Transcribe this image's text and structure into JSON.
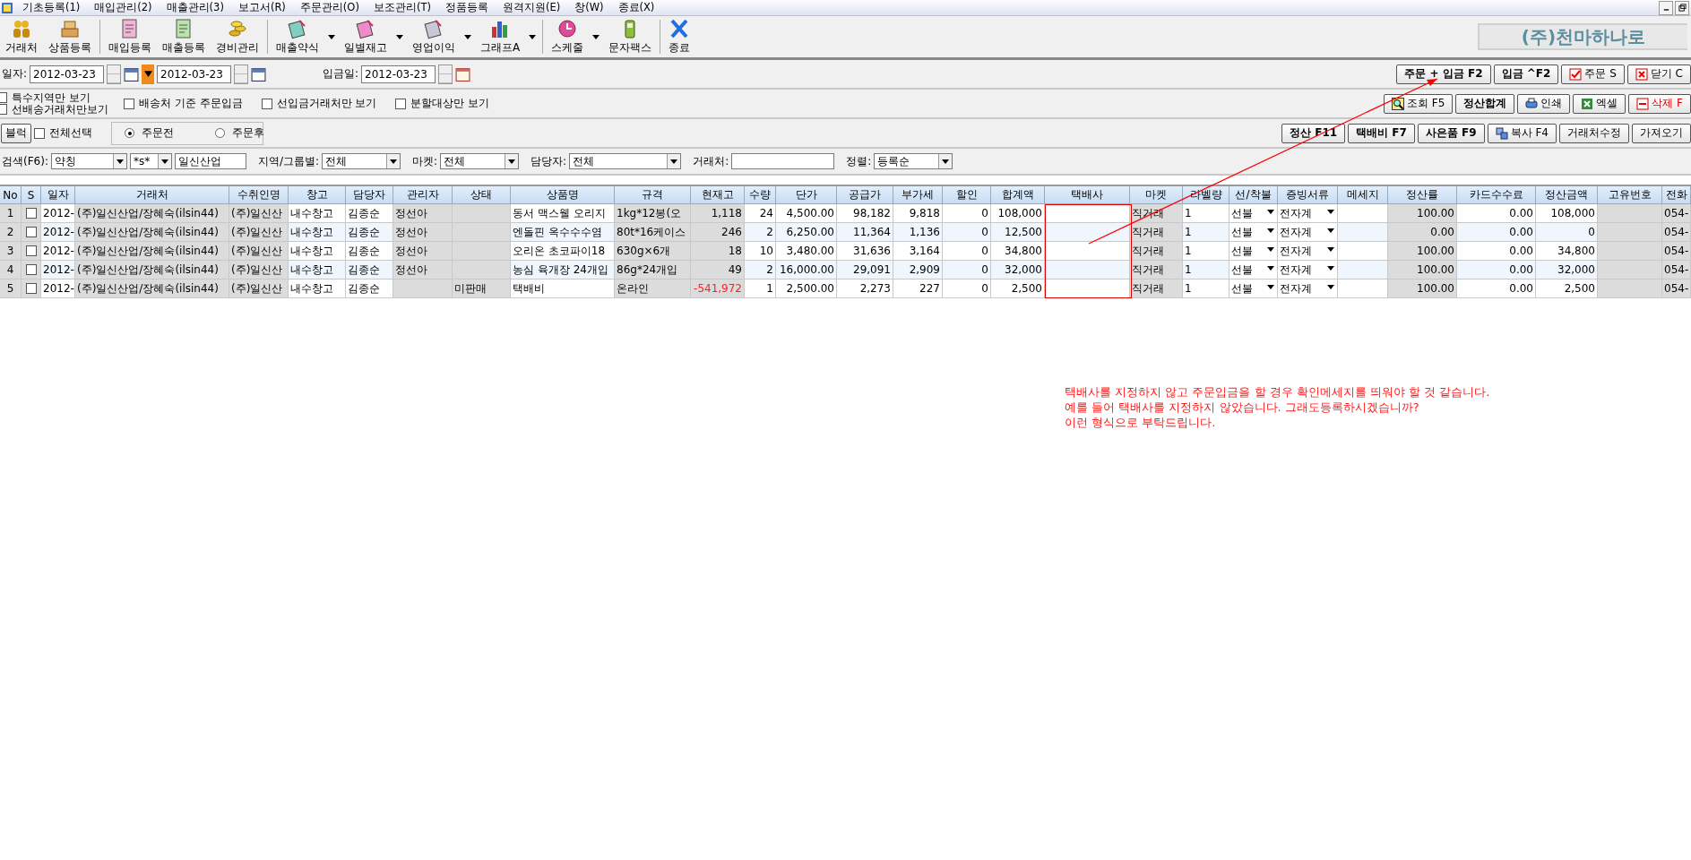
{
  "menu": [
    "기초등록(1)",
    "매입관리(2)",
    "매출관리(3)",
    "보고서(R)",
    "주문관리(O)",
    "보조관리(T)",
    "정품등록",
    "원격지원(E)",
    "창(W)",
    "종료(X)"
  ],
  "toolbar": [
    {
      "label": "거래처",
      "has_menu": false
    },
    {
      "label": "상품등록",
      "has_menu": false
    },
    {
      "label": "매입등록",
      "has_menu": false
    },
    {
      "label": "매출등록",
      "has_menu": false
    },
    {
      "label": "경비관리",
      "has_menu": false
    },
    {
      "label": "매출약식",
      "has_menu": true
    },
    {
      "label": "일별재고",
      "has_menu": true
    },
    {
      "label": "영업이익",
      "has_menu": true
    },
    {
      "label": "그래프A",
      "has_menu": true
    },
    {
      "label": "스케줄",
      "has_menu": true
    },
    {
      "label": "문자팩스",
      "has_menu": false
    },
    {
      "label": "종료",
      "has_menu": false
    }
  ],
  "company": "(주)천마하나로",
  "date_row": {
    "label": "일자:",
    "from": "2012-03-23",
    "to": "2012-03-23",
    "deposit_label": "입금일:",
    "deposit_date": "2012-03-23"
  },
  "row1_buttons": [
    {
      "label": "주문 + 입금 F2",
      "bold": true
    },
    {
      "label": "입금 ^F2",
      "bold": true
    },
    {
      "label": "주문 S",
      "bold": false
    },
    {
      "label": "닫기 C",
      "bold": false
    }
  ],
  "filters": [
    {
      "label": "특수지역만 보기",
      "checked": false
    },
    {
      "label": "선배송거래처만보기",
      "checked": false
    },
    {
      "label": "배송처 기준 주문입금",
      "checked": false
    },
    {
      "label": "선입금거래처만 보기",
      "checked": false
    },
    {
      "label": "분할대상만 보기",
      "checked": false
    }
  ],
  "row2_buttons": [
    {
      "label": "조회 F5",
      "bold": false
    },
    {
      "label": "정산합계",
      "bold": true
    },
    {
      "label": "인쇄",
      "bold": false
    },
    {
      "label": "엑셀",
      "bold": false
    },
    {
      "label": "삭제 F",
      "bold": false
    }
  ],
  "block_button": "블럭",
  "select_all": {
    "label": "전체선택",
    "checked": false
  },
  "order_radio": [
    {
      "label": "주문전",
      "selected": true
    },
    {
      "label": "주문후",
      "selected": false
    }
  ],
  "row3_buttons": [
    {
      "label": "정산 F11",
      "bold": true
    },
    {
      "label": "택배비 F7",
      "bold": true
    },
    {
      "label": "사은품 F9",
      "bold": true
    },
    {
      "label": "복사 F4",
      "bold": false
    },
    {
      "label": "거래처수정",
      "bold": false
    },
    {
      "label": "가져오기",
      "bold": false
    }
  ],
  "search": {
    "label": "검색(F6):",
    "field": "약칭",
    "mode": "*s*",
    "value": "일신산업",
    "region_label": "지역/그룹별:",
    "region": "전체",
    "market_label": "마켓:",
    "market": "전체",
    "manager_label": "담당자:",
    "manager": "전체",
    "client_label": "거래처:",
    "sort_label": "정렬:",
    "sort": "등록순"
  },
  "table": {
    "columns": [
      "No",
      "S",
      "일자",
      "거래처",
      "수취인명",
      "창고",
      "담당자",
      "관리자",
      "상태",
      "상품명",
      "규격",
      "현재고",
      "수량",
      "단가",
      "공급가",
      "부가세",
      "할인",
      "합계액",
      "택배사",
      "마켓",
      "라벨량",
      "선/착불",
      "증빙서류",
      "메세지",
      "정산률",
      "카드수수료",
      "정산금액",
      "고유번호",
      "전화"
    ],
    "rows": [
      {
        "checked": false,
        "stock_negative": false,
        "cells": [
          "1",
          "",
          "2012-",
          "(주)일신산업/장혜숙(ilsin44)",
          "(주)일신산",
          "내수창고",
          "김종순",
          "정선아",
          "",
          "동서 맥스웰 오리지",
          "1kg*12봉(오",
          "1,118",
          "24",
          "4,500.00",
          "98,182",
          "9,818",
          "0",
          "108,000",
          "",
          "직거래",
          "1",
          "선불",
          "전자계",
          "",
          "100.00",
          "0.00",
          "108,000",
          "",
          "054-"
        ]
      },
      {
        "checked": false,
        "stock_negative": false,
        "cells": [
          "2",
          "",
          "2012-",
          "(주)일신산업/장혜숙(ilsin44)",
          "(주)일신산",
          "내수창고",
          "김종순",
          "정선아",
          "",
          "엔돌핀 옥수수수염",
          "80t*16케이스",
          "246",
          "2",
          "6,250.00",
          "11,364",
          "1,136",
          "0",
          "12,500",
          "",
          "직거래",
          "1",
          "선불",
          "전자계",
          "",
          "0.00",
          "0.00",
          "0",
          "",
          "054-"
        ]
      },
      {
        "checked": false,
        "stock_negative": false,
        "cells": [
          "3",
          "",
          "2012-",
          "(주)일신산업/장혜숙(ilsin44)",
          "(주)일신산",
          "내수창고",
          "김종순",
          "정선아",
          "",
          "오리온 초코파이18",
          "630g×6개",
          "18",
          "10",
          "3,480.00",
          "31,636",
          "3,164",
          "0",
          "34,800",
          "",
          "직거래",
          "1",
          "선불",
          "전자계",
          "",
          "100.00",
          "0.00",
          "34,800",
          "",
          "054-"
        ]
      },
      {
        "checked": false,
        "stock_negative": false,
        "cells": [
          "4",
          "",
          "2012-",
          "(주)일신산업/장혜숙(ilsin44)",
          "(주)일신산",
          "내수창고",
          "김종순",
          "정선아",
          "",
          "농심 육개장 24개입",
          "86g*24개입",
          "49",
          "2",
          "16,000.00",
          "29,091",
          "2,909",
          "0",
          "32,000",
          "",
          "직거래",
          "1",
          "선불",
          "전자계",
          "",
          "100.00",
          "0.00",
          "32,000",
          "",
          "054-"
        ]
      },
      {
        "checked": false,
        "stock_negative": true,
        "cells": [
          "5",
          "",
          "2012-",
          "(주)일신산업/장혜숙(ilsin44)",
          "(주)일신산",
          "내수창고",
          "김종순",
          "",
          "미판매",
          "택배비",
          "온라인",
          "-541,972",
          "1",
          "2,500.00",
          "2,273",
          "227",
          "0",
          "2,500",
          "",
          "직거래",
          "1",
          "선불",
          "전자계",
          "",
          "100.00",
          "0.00",
          "2,500",
          "",
          "054-"
        ]
      }
    ]
  },
  "note": [
    "택배사를 지정하지 않고 주문입금을 할 경우 확인메세지를 띄워야 할 것 같습니다.",
    "예를 들어 택배사를 지정하지 않았습니다. 그래도등록하시겠습니까?",
    "이런 형식으로 부탁드립니다."
  ]
}
